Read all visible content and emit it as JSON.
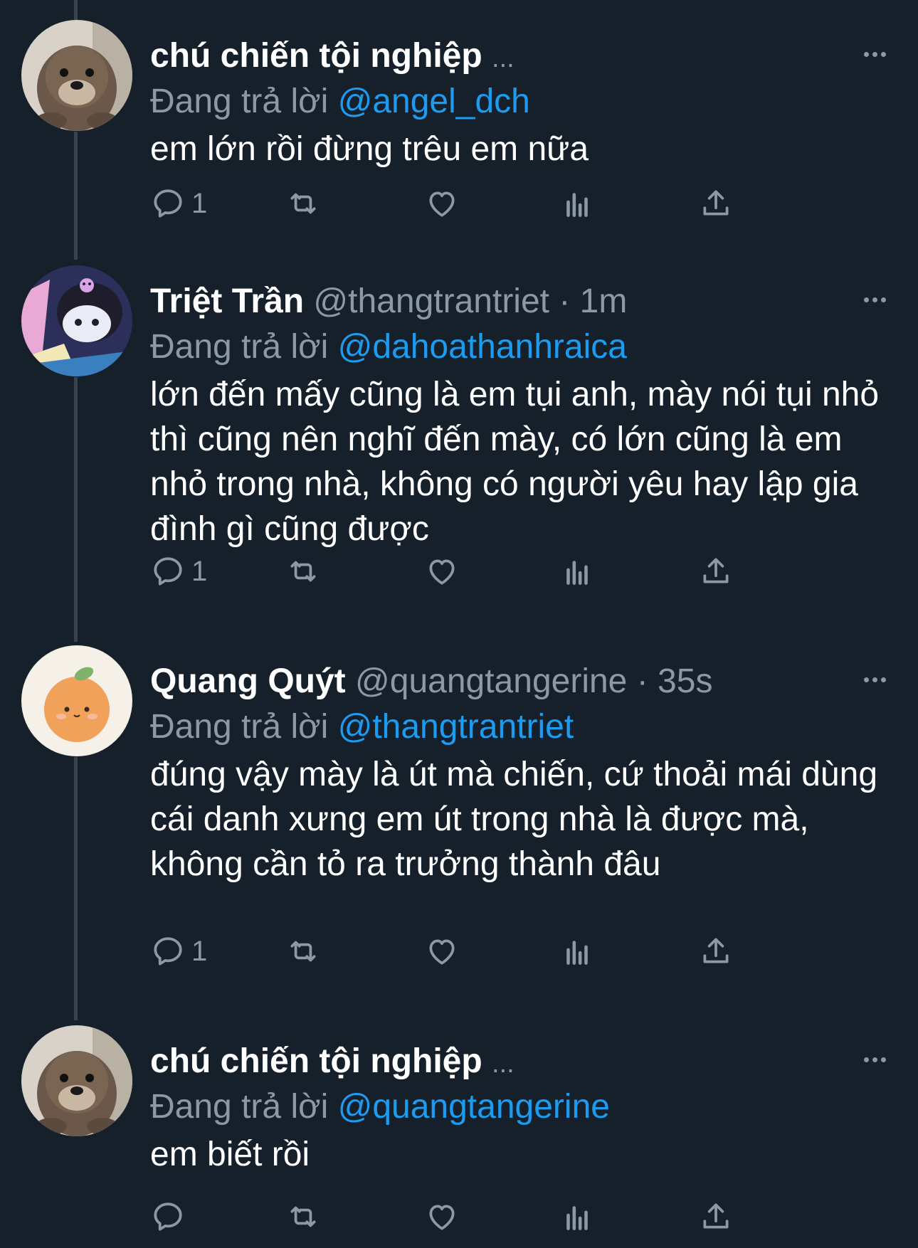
{
  "colors": {
    "background": "#15202b",
    "text_primary": "#ffffff",
    "text_secondary": "#8b98a5",
    "mention": "#1d9bf0",
    "thread_line": "#38444d"
  },
  "tweets": [
    {
      "name": "chú chiến tội nghiệp",
      "handle": "",
      "separator": "",
      "time": "",
      "ellipsis": "...",
      "reply_prefix": "Đang trả lời",
      "reply_to": "@angel_dch",
      "text": "em lớn rồi đừng trêu em nữa",
      "reply_count": "1",
      "avatar_icon": "otter-avatar"
    },
    {
      "name": "Triệt Trần",
      "handle": "@thangtrantriet",
      "separator": "·",
      "time": "1m",
      "ellipsis": "",
      "reply_prefix": "Đang trả lời",
      "reply_to": "@dahoathanhraica",
      "text": "lớn đến mấy cũng là em tụi anh, mày nói tụi nhỏ thì cũng nên nghĩ đến mày, có lớn cũng là em nhỏ trong nhà, không có người yêu hay lập gia đình gì cũng được",
      "reply_count": "1",
      "avatar_icon": "kuromi-avatar"
    },
    {
      "name": "Quang Quýt",
      "handle": "@quangtangerine",
      "separator": "·",
      "time": "35s",
      "ellipsis": "",
      "reply_prefix": "Đang trả lời",
      "reply_to": "@thangtrantriet",
      "text": "đúng vậy mày là út mà chiến, cứ thoải mái dùng cái danh xưng em út trong nhà là được mà, không cần tỏ ra trưởng thành đâu",
      "reply_count": "1",
      "avatar_icon": "tangerine-avatar"
    },
    {
      "name": "chú chiến tội nghiệp",
      "handle": "",
      "separator": "",
      "time": "",
      "ellipsis": "...",
      "reply_prefix": "Đang trả lời",
      "reply_to": "@quangtangerine",
      "text": "em biết rồi",
      "reply_count": "",
      "avatar_icon": "otter-avatar"
    }
  ],
  "icons": {
    "more": "more-horizontal-icon",
    "reply": "reply-icon",
    "retweet": "retweet-icon",
    "like": "heart-icon",
    "views": "views-icon",
    "share": "share-icon"
  }
}
